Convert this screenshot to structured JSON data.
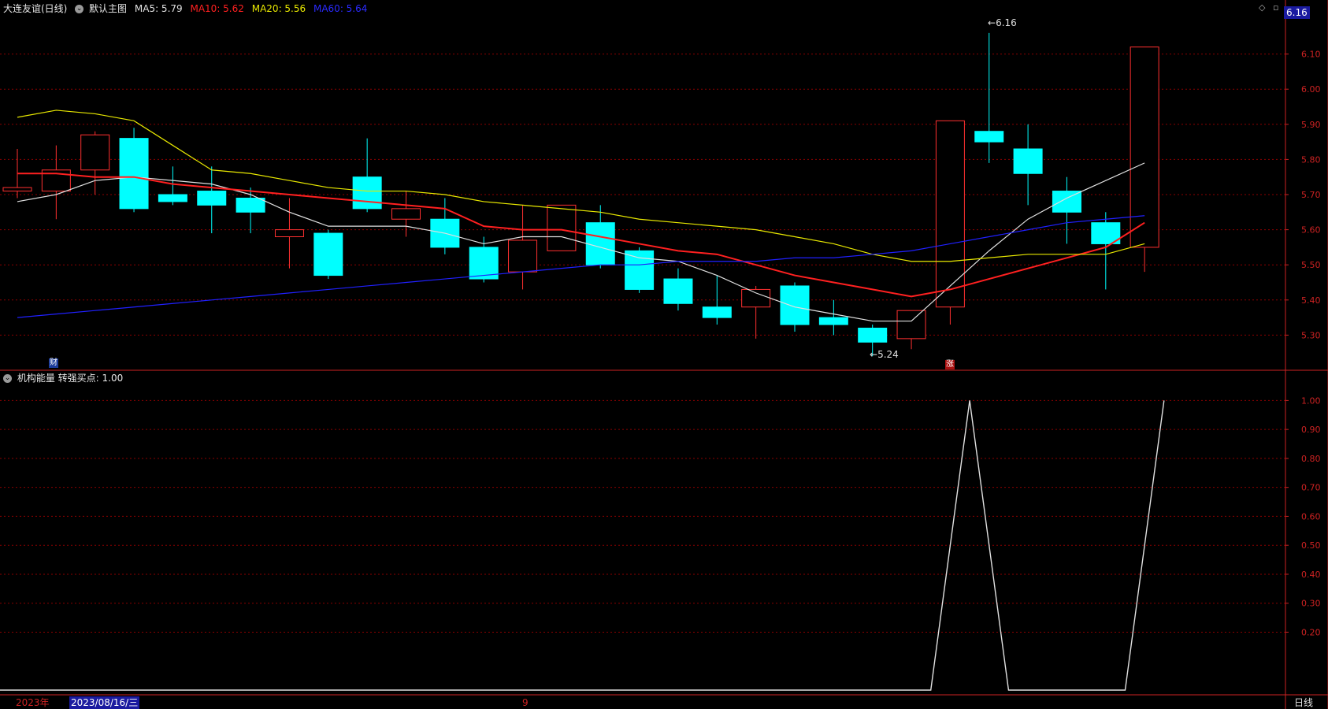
{
  "header": {
    "stock_name": "大连友谊(日线)",
    "template_label": "默认主图",
    "ma": [
      {
        "label": "MA5: 5.79",
        "color": "#e0e0e0"
      },
      {
        "label": "MA10: 5.62",
        "color": "#ff2020"
      },
      {
        "label": "MA20: 5.56",
        "color": "#e8e800"
      },
      {
        "label": "MA60: 5.64",
        "color": "#2020ff"
      }
    ]
  },
  "sub_header": {
    "indicator_label": "机构能量  转强买点: 1.00"
  },
  "price_tag": "6.16",
  "annotations": {
    "high_label": "6.16",
    "low_label": "5.24",
    "cai_marker": "财",
    "zhang_marker": "涨"
  },
  "footer": {
    "year_label": "2023年",
    "date_label": "2023/08/16/三",
    "month_label": "9",
    "period_label": "日线"
  },
  "colors": {
    "up": "#ff3030",
    "down": "#00ffff",
    "grid": "#8b0000",
    "axis": "#cc2222"
  },
  "chart_data": [
    {
      "type": "candlestick",
      "title": "大连友谊(日线)",
      "ylim": [
        5.2,
        6.2
      ],
      "yticks": [
        "6.10",
        "6.00",
        "5.90",
        "5.80",
        "5.70",
        "5.60",
        "5.50",
        "5.40",
        "5.30"
      ],
      "candles": [
        {
          "o": 5.71,
          "h": 5.83,
          "l": 5.69,
          "c": 5.72
        },
        {
          "o": 5.71,
          "h": 5.84,
          "l": 5.63,
          "c": 5.77
        },
        {
          "o": 5.77,
          "h": 5.88,
          "l": 5.7,
          "c": 5.87
        },
        {
          "o": 5.86,
          "h": 5.89,
          "l": 5.65,
          "c": 5.66
        },
        {
          "o": 5.7,
          "h": 5.78,
          "l": 5.67,
          "c": 5.68
        },
        {
          "o": 5.71,
          "h": 5.78,
          "l": 5.59,
          "c": 5.67
        },
        {
          "o": 5.69,
          "h": 5.72,
          "l": 5.59,
          "c": 5.65
        },
        {
          "o": 5.58,
          "h": 5.69,
          "l": 5.49,
          "c": 5.6
        },
        {
          "o": 5.59,
          "h": 5.6,
          "l": 5.46,
          "c": 5.47
        },
        {
          "o": 5.75,
          "h": 5.86,
          "l": 5.65,
          "c": 5.66
        },
        {
          "o": 5.63,
          "h": 5.71,
          "l": 5.58,
          "c": 5.66
        },
        {
          "o": 5.63,
          "h": 5.69,
          "l": 5.53,
          "c": 5.55
        },
        {
          "o": 5.55,
          "h": 5.58,
          "l": 5.45,
          "c": 5.46
        },
        {
          "o": 5.48,
          "h": 5.67,
          "l": 5.43,
          "c": 5.57
        },
        {
          "o": 5.54,
          "h": 5.67,
          "l": 5.54,
          "c": 5.67
        },
        {
          "o": 5.62,
          "h": 5.67,
          "l": 5.49,
          "c": 5.5
        },
        {
          "o": 5.54,
          "h": 5.55,
          "l": 5.42,
          "c": 5.43
        },
        {
          "o": 5.46,
          "h": 5.49,
          "l": 5.37,
          "c": 5.39
        },
        {
          "o": 5.38,
          "h": 5.47,
          "l": 5.33,
          "c": 5.35
        },
        {
          "o": 5.38,
          "h": 5.44,
          "l": 5.29,
          "c": 5.43
        },
        {
          "o": 5.44,
          "h": 5.45,
          "l": 5.31,
          "c": 5.33
        },
        {
          "o": 5.35,
          "h": 5.4,
          "l": 5.3,
          "c": 5.33
        },
        {
          "o": 5.32,
          "h": 5.33,
          "l": 5.24,
          "c": 5.28
        },
        {
          "o": 5.29,
          "h": 5.37,
          "l": 5.26,
          "c": 5.37
        },
        {
          "o": 5.38,
          "h": 5.91,
          "l": 5.33,
          "c": 5.91
        },
        {
          "o": 5.88,
          "h": 6.16,
          "l": 5.79,
          "c": 5.85
        },
        {
          "o": 5.83,
          "h": 5.9,
          "l": 5.67,
          "c": 5.76
        },
        {
          "o": 5.71,
          "h": 5.75,
          "l": 5.56,
          "c": 5.65
        },
        {
          "o": 5.62,
          "h": 5.65,
          "l": 5.43,
          "c": 5.56
        },
        {
          "o": 5.55,
          "h": 6.12,
          "l": 5.48,
          "c": 6.12
        }
      ],
      "series": [
        {
          "name": "MA5",
          "color": "#e0e0e0",
          "values": [
            5.68,
            5.7,
            5.74,
            5.75,
            5.74,
            5.73,
            5.7,
            5.65,
            5.61,
            5.61,
            5.61,
            5.59,
            5.56,
            5.58,
            5.58,
            5.55,
            5.52,
            5.51,
            5.47,
            5.42,
            5.38,
            5.36,
            5.34,
            5.34,
            5.44,
            5.54,
            5.63,
            5.69,
            5.74,
            5.79
          ]
        },
        {
          "name": "MA10",
          "color": "#ff2020",
          "values": [
            5.76,
            5.76,
            5.75,
            5.75,
            5.73,
            5.72,
            5.71,
            5.7,
            5.69,
            5.68,
            5.67,
            5.66,
            5.61,
            5.6,
            5.6,
            5.58,
            5.56,
            5.54,
            5.53,
            5.5,
            5.47,
            5.45,
            5.43,
            5.41,
            5.43,
            5.46,
            5.49,
            5.52,
            5.55,
            5.62
          ]
        },
        {
          "name": "MA20",
          "color": "#e8e800",
          "values": [
            5.92,
            5.94,
            5.93,
            5.91,
            5.84,
            5.77,
            5.76,
            5.74,
            5.72,
            5.71,
            5.71,
            5.7,
            5.68,
            5.67,
            5.66,
            5.65,
            5.63,
            5.62,
            5.61,
            5.6,
            5.58,
            5.56,
            5.53,
            5.51,
            5.51,
            5.52,
            5.53,
            5.53,
            5.53,
            5.56
          ]
        },
        {
          "name": "MA60",
          "color": "#2020ff",
          "values": [
            5.35,
            5.36,
            5.37,
            5.38,
            5.39,
            5.4,
            5.41,
            5.42,
            5.43,
            5.44,
            5.45,
            5.46,
            5.47,
            5.48,
            5.49,
            5.5,
            5.5,
            5.51,
            5.51,
            5.51,
            5.52,
            5.52,
            5.53,
            5.54,
            5.56,
            5.58,
            5.6,
            5.62,
            5.63,
            5.64
          ]
        }
      ]
    },
    {
      "type": "line",
      "title": "机构能量  转强买点: 1.00",
      "ylim": [
        0,
        1.05
      ],
      "yticks": [
        "1.00",
        "0.90",
        "0.80",
        "0.70",
        "0.60",
        "0.50",
        "0.40",
        "0.30",
        "0.20"
      ],
      "x_start_index": -0.5,
      "series": [
        {
          "name": "转强买点",
          "color": "#e0e0e0",
          "values": [
            0,
            0,
            0,
            0,
            0,
            0,
            0,
            0,
            0,
            0,
            0,
            0,
            0,
            0,
            0,
            0,
            0,
            0,
            0,
            0,
            0,
            0,
            0,
            0,
            0,
            1,
            0,
            0,
            0,
            0,
            1
          ]
        }
      ]
    }
  ]
}
